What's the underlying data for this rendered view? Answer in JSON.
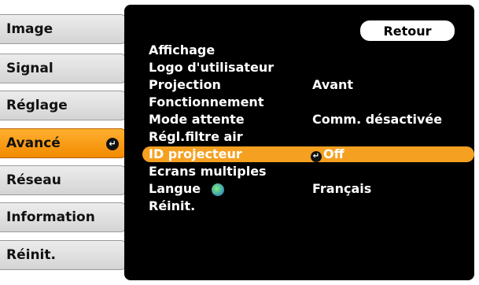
{
  "sidebar": {
    "tabs": [
      {
        "label": "Image"
      },
      {
        "label": "Signal"
      },
      {
        "label": "Réglage"
      },
      {
        "label": "Avancé",
        "active": true
      },
      {
        "label": "Réseau"
      },
      {
        "label": "Information"
      },
      {
        "label": "Réinit."
      }
    ]
  },
  "panel": {
    "back_label": "Retour",
    "items": [
      {
        "label": "Affichage",
        "value": ""
      },
      {
        "label": "Logo d'utilisateur",
        "value": ""
      },
      {
        "label": "Projection",
        "value": "Avant"
      },
      {
        "label": "Fonctionnement",
        "value": ""
      },
      {
        "label": "Mode attente",
        "value": "Comm. désactivée"
      },
      {
        "label": "Régl.filtre air",
        "value": ""
      },
      {
        "label": "ID projecteur",
        "value": "Off",
        "selected": true
      },
      {
        "label": "Ecrans multiples",
        "value": ""
      },
      {
        "label": "Langue",
        "value": "Français"
      },
      {
        "label": "Réinit.",
        "value": ""
      }
    ]
  },
  "colors": {
    "active_tab": "#f28a00",
    "panel_bg": "#000000",
    "selected_row": "#f5a020"
  },
  "icons": {
    "enter": "enter-icon",
    "globe": "globe-icon"
  }
}
